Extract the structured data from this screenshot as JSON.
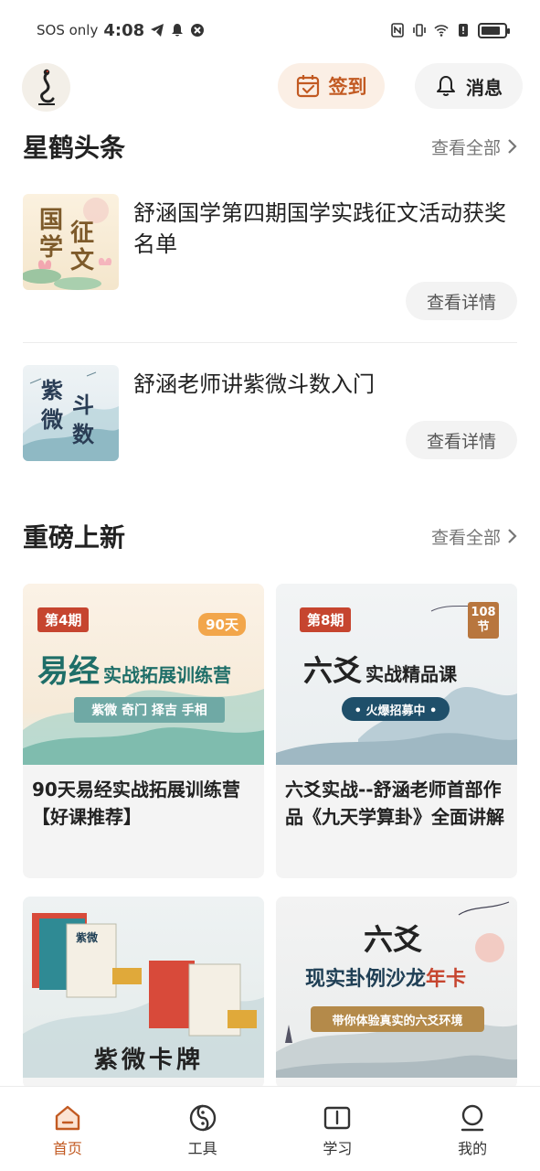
{
  "status_bar": {
    "carrier": "SOS only",
    "time": "4:08",
    "battery_level": 0.85
  },
  "header": {
    "checkin_label": "签到",
    "message_label": "消息"
  },
  "headlines": {
    "title": "星鹤头条",
    "see_all": "查看全部",
    "items": [
      {
        "title": "舒涵国学第四期国学实践征文活动获奖名单",
        "thumb_text": [
          "国",
          "学",
          "征",
          "文"
        ],
        "button": "查看详情"
      },
      {
        "title": "舒涵老师讲紫微斗数入门",
        "thumb_text": [
          "紫",
          "微",
          "斗",
          "数"
        ],
        "button": "查看详情"
      }
    ]
  },
  "new_courses": {
    "title": "重磅上新",
    "see_all": "查看全部",
    "cards": [
      {
        "badge": "第4期",
        "corner": "90天",
        "headline_big": "易经",
        "headline_small": "实战拓展训练营",
        "ribbon": "紫微 奇门 择吉 手相",
        "title": "90天易经实战拓展训练营【好课推荐】"
      },
      {
        "badge": "第8期",
        "corner": "108节",
        "headline_big": "六爻",
        "headline_small": "实战精品课",
        "ribbon": "• 火爆招募中 •",
        "title": "六爻实战--舒涵老师首部作品《九天学算卦》全面讲解"
      },
      {
        "caption": "紫微卡牌",
        "box_label": "紫微"
      },
      {
        "headline_big": "六爻",
        "headline_small_a": "现实卦例沙龙",
        "headline_small_b": "年卡",
        "ribbon": "带你体验真实的六爻环境"
      }
    ]
  },
  "tabs": [
    {
      "label": "首页",
      "icon": "home-icon",
      "active": true
    },
    {
      "label": "工具",
      "icon": "yinyang-icon",
      "active": false
    },
    {
      "label": "学习",
      "icon": "book-icon",
      "active": false
    },
    {
      "label": "我的",
      "icon": "profile-icon",
      "active": false
    }
  ],
  "colors": {
    "accent": "#c25a22",
    "checkin_bg": "#fbefe5"
  }
}
